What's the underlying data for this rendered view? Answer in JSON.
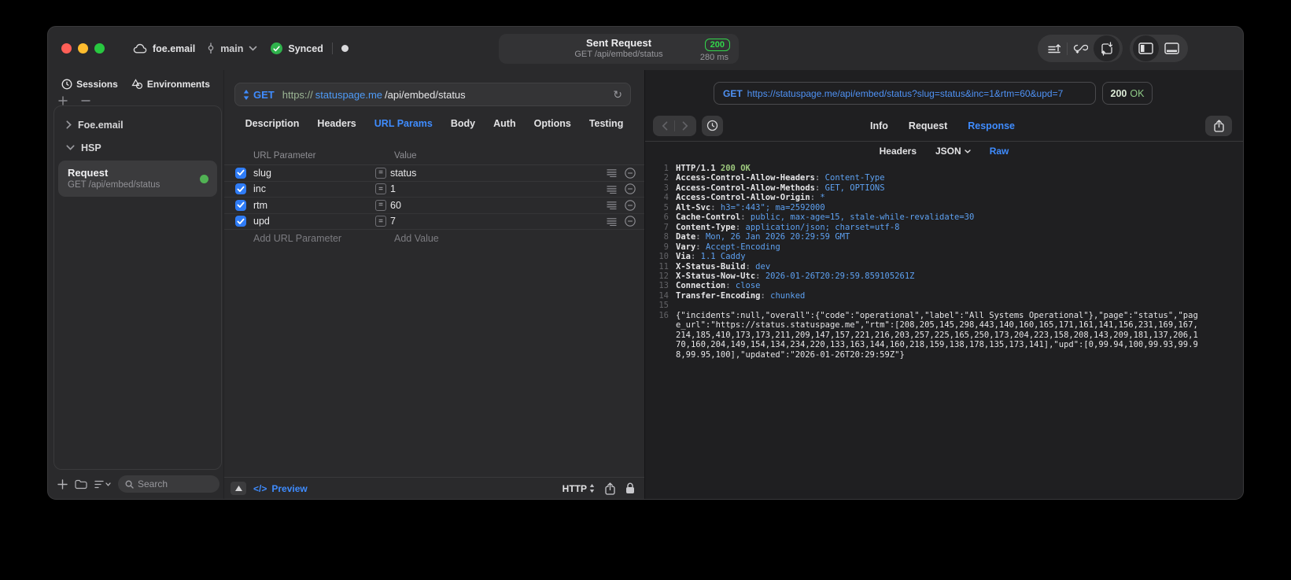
{
  "titlebar": {
    "project": "foe.email",
    "branch": "main",
    "sync_status": "Synced",
    "title": "Sent Request",
    "subtitle": "GET /api/embed/status",
    "status_badge": "200",
    "duration": "280 ms"
  },
  "sidebar": {
    "tabs": [
      {
        "label": "Sessions",
        "icon": "clock-icon"
      },
      {
        "label": "Environments",
        "icon": "shapes-icon"
      }
    ],
    "tree": [
      {
        "label": "Foe.email",
        "expanded": false
      },
      {
        "label": "HSP",
        "expanded": true
      }
    ],
    "request_item": {
      "title": "Request",
      "subtitle": "GET /api/embed/status"
    },
    "search_placeholder": "Search"
  },
  "request_editor": {
    "method": "GET",
    "url": {
      "scheme": "https://",
      "host": "statuspage.me",
      "path": "/api/embed/status"
    },
    "tabs": [
      "Description",
      "Headers",
      "URL Params",
      "Body",
      "Auth",
      "Options",
      "Testing"
    ],
    "active_tab": "URL Params",
    "params": {
      "column_headers": [
        "URL Parameter",
        "Value"
      ],
      "rows": [
        {
          "name": "slug",
          "value": "status",
          "enabled": true
        },
        {
          "name": "inc",
          "value": "1",
          "enabled": true
        },
        {
          "name": "rtm",
          "value": "60",
          "enabled": true
        },
        {
          "name": "upd",
          "value": "7",
          "enabled": true
        }
      ],
      "add_name_placeholder": "Add URL Parameter",
      "add_value_placeholder": "Add Value"
    },
    "footer": {
      "code_glyph": "</>",
      "preview_label": "Preview",
      "protocol": "HTTP"
    }
  },
  "response_viewer": {
    "request_line": {
      "method": "GET",
      "url": "https://statuspage.me/api/embed/status?slug=status&inc=1&rtm=60&upd=7"
    },
    "status_code": "200",
    "status_text": "OK",
    "tabs": [
      "Info",
      "Request",
      "Response"
    ],
    "active_tab": "Response",
    "subtabs": [
      {
        "label": "Headers",
        "dropdown": false
      },
      {
        "label": "JSON",
        "dropdown": true
      },
      {
        "label": "Raw",
        "dropdown": false
      }
    ],
    "active_subtab": "Raw",
    "raw": {
      "status_line": {
        "protocol": "HTTP/1.1",
        "status": "200 OK"
      },
      "headers": [
        {
          "name": "Access-Control-Allow-Headers",
          "value": "Content-Type"
        },
        {
          "name": "Access-Control-Allow-Methods",
          "value": "GET, OPTIONS"
        },
        {
          "name": "Access-Control-Allow-Origin",
          "value": "*"
        },
        {
          "name": "Alt-Svc",
          "value": "h3=\":443\"; ma=2592000"
        },
        {
          "name": "Cache-Control",
          "value": "public, max-age=15, stale-while-revalidate=30"
        },
        {
          "name": "Content-Type",
          "value": "application/json; charset=utf-8"
        },
        {
          "name": "Date",
          "value": "Mon, 26 Jan 2026 20:29:59 GMT"
        },
        {
          "name": "Vary",
          "value": "Accept-Encoding"
        },
        {
          "name": "Via",
          "value": "1.1 Caddy"
        },
        {
          "name": "X-Status-Build",
          "value": "dev"
        },
        {
          "name": "X-Status-Now-Utc",
          "value": "2026-01-26T20:29:59.859105261Z"
        },
        {
          "name": "Connection",
          "value": "close"
        },
        {
          "name": "Transfer-Encoding",
          "value": "chunked"
        }
      ],
      "body": "{\"incidents\":null,\"overall\":{\"code\":\"operational\",\"label\":\"All Systems Operational\"},\"page\":\"status\",\"page_url\":\"https://status.statuspage.me\",\"rtm\":[208,205,145,298,443,140,160,165,171,161,141,156,231,169,167,214,185,410,173,173,211,209,147,157,221,216,203,257,225,165,250,173,204,223,158,208,143,209,181,137,206,170,160,204,149,154,134,234,220,133,163,144,160,218,159,138,178,135,173,141],\"upd\":[0,99.94,100,99.93,99.98,99.95,100],\"updated\":\"2026-01-26T20:29:59Z\"}"
    }
  },
  "colors": {
    "accent_blue": "#3f8cff",
    "status_green": "#32d74b",
    "param_checkbox_blue": "#2f7cf6",
    "code_value_blue": "#5da0f0",
    "code_green": "#9dc87d"
  }
}
